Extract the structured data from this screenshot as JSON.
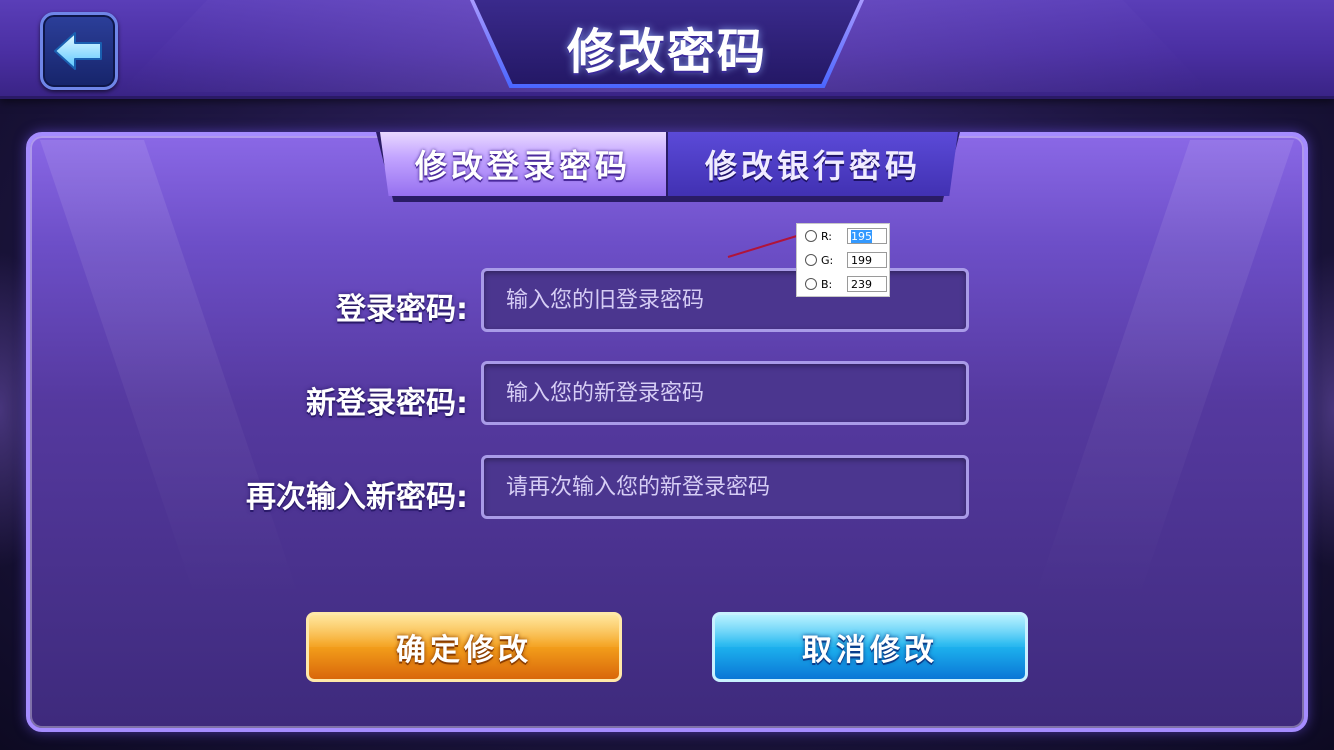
{
  "header": {
    "title": "修改密码",
    "back_icon": "arrow-left-icon"
  },
  "tabs": [
    {
      "label": "修改登录密码",
      "active": true
    },
    {
      "label": "修改银行密码",
      "active": false
    }
  ],
  "form": {
    "rows": [
      {
        "label": "登录密码:",
        "placeholder": "输入您的旧登录密码"
      },
      {
        "label": "新登录密码:",
        "placeholder": "输入您的新登录密码"
      },
      {
        "label": "再次输入新密码:",
        "placeholder": "请再次输入您的新登录密码"
      }
    ]
  },
  "buttons": {
    "confirm_label": "确定修改",
    "cancel_label": "取消修改"
  },
  "color_picker": {
    "r_label": "R:",
    "r_value": "195",
    "g_label": "G:",
    "g_value": "199",
    "b_label": "B:",
    "b_value": "239"
  },
  "colors": {
    "accent": "#a58cff",
    "confirm": "#f5a31c",
    "cancel": "#1fb7f0"
  }
}
